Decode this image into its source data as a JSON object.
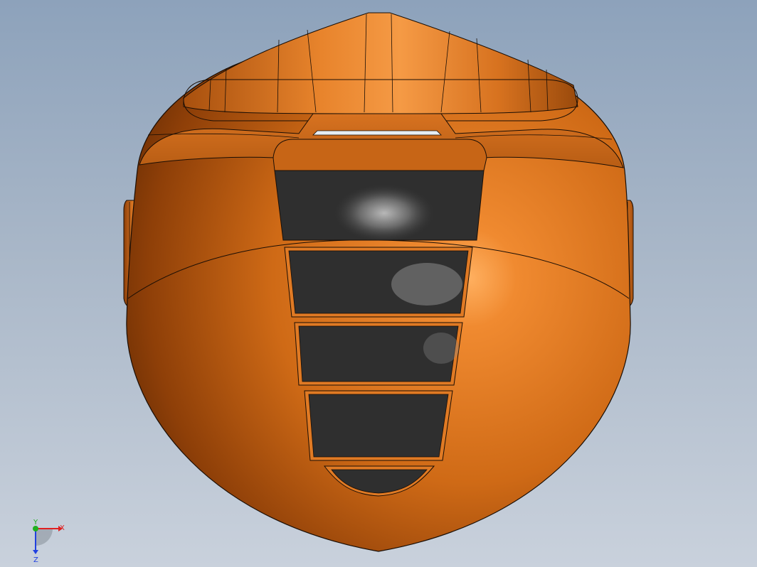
{
  "viewport": {
    "background_top": "#8da2bb",
    "background_bottom": "#c9d1dc"
  },
  "model": {
    "body_color": "#d9761e",
    "highlight_color": "#f59a45",
    "shadow_color": "#6b2e05",
    "visor_color": "#2f2f2f",
    "edge_color": "#1a0e05",
    "visor_slats": 5
  },
  "triad": {
    "x_label": "X",
    "y_label": "Y",
    "z_label": "Z",
    "x_color": "#e02020",
    "y_color": "#20b020",
    "z_color": "#2040e0"
  }
}
